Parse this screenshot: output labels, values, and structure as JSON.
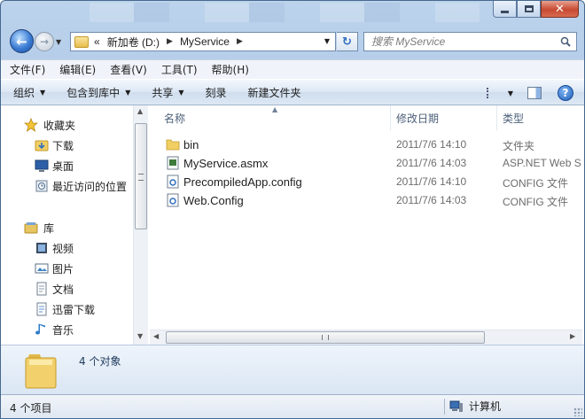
{
  "window": {
    "caption_buttons": {
      "minimize": "minimize",
      "maximize": "maximize",
      "close": "close"
    }
  },
  "nav": {
    "breadcrumb": {
      "overflow": "«",
      "segments": [
        "新加卷 (D:)",
        "MyService"
      ]
    },
    "search": {
      "placeholder": "搜索 MyService"
    }
  },
  "menu": [
    "文件(F)",
    "编辑(E)",
    "查看(V)",
    "工具(T)",
    "帮助(H)"
  ],
  "toolbar": {
    "organize": "组织",
    "include_in_library": "包含到库中",
    "share": "共享",
    "burn": "刻录",
    "new_folder": "新建文件夹"
  },
  "sidebar": {
    "favorites": {
      "label": "收藏夹",
      "items": [
        "下载",
        "桌面",
        "最近访问的位置"
      ]
    },
    "libraries": {
      "label": "库",
      "items": [
        "视频",
        "图片",
        "文档",
        "迅雷下载",
        "音乐"
      ]
    }
  },
  "file_list": {
    "columns": [
      "名称",
      "修改日期",
      "类型"
    ],
    "rows": [
      {
        "name": "bin",
        "date": "2011/7/6 14:10",
        "type": "文件夹",
        "icon": "folder-icon"
      },
      {
        "name": "MyService.asmx",
        "date": "2011/7/6 14:03",
        "type": "ASP.NET Web S",
        "icon": "asmx-file-icon"
      },
      {
        "name": "PrecompiledApp.config",
        "date": "2011/7/6 14:10",
        "type": "CONFIG 文件",
        "icon": "config-file-icon"
      },
      {
        "name": "Web.Config",
        "date": "2011/7/6 14:03",
        "type": "CONFIG 文件",
        "icon": "config-file-icon"
      }
    ]
  },
  "details": {
    "text": "4 个对象"
  },
  "status": {
    "left": "4 个项目",
    "right": "计算机"
  },
  "colors": {
    "accent": "#2f6ebf",
    "folder": "#e7bd4d",
    "secondary_text": "#6d6d6d"
  }
}
